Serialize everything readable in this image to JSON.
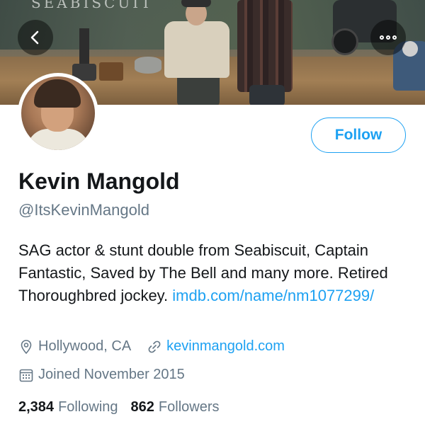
{
  "banner": {
    "logo_text": "SEABISCUIT"
  },
  "nav": {
    "back_icon": "chevron-left-icon",
    "more_icon": "more-horizontal-icon"
  },
  "profile": {
    "name": "Kevin Mangold",
    "handle": "@ItsKevinMangold",
    "follow_label": "Follow",
    "bio_text": "SAG actor & stunt double from Seabiscuit, Captain Fantastic, Saved by The Bell and many more. Retired Thoroughbred jockey.",
    "bio_link": "imdb.com/name/nm1077299/",
    "location": "Hollywood, CA",
    "website": "kevinmangold.com",
    "joined": "Joined November 2015"
  },
  "stats": {
    "following_count": "2,384",
    "following_label": "Following",
    "followers_count": "862",
    "followers_label": "Followers"
  },
  "colors": {
    "accent": "#1da1f2",
    "secondary_text": "#657786",
    "primary_text": "#14171a"
  }
}
